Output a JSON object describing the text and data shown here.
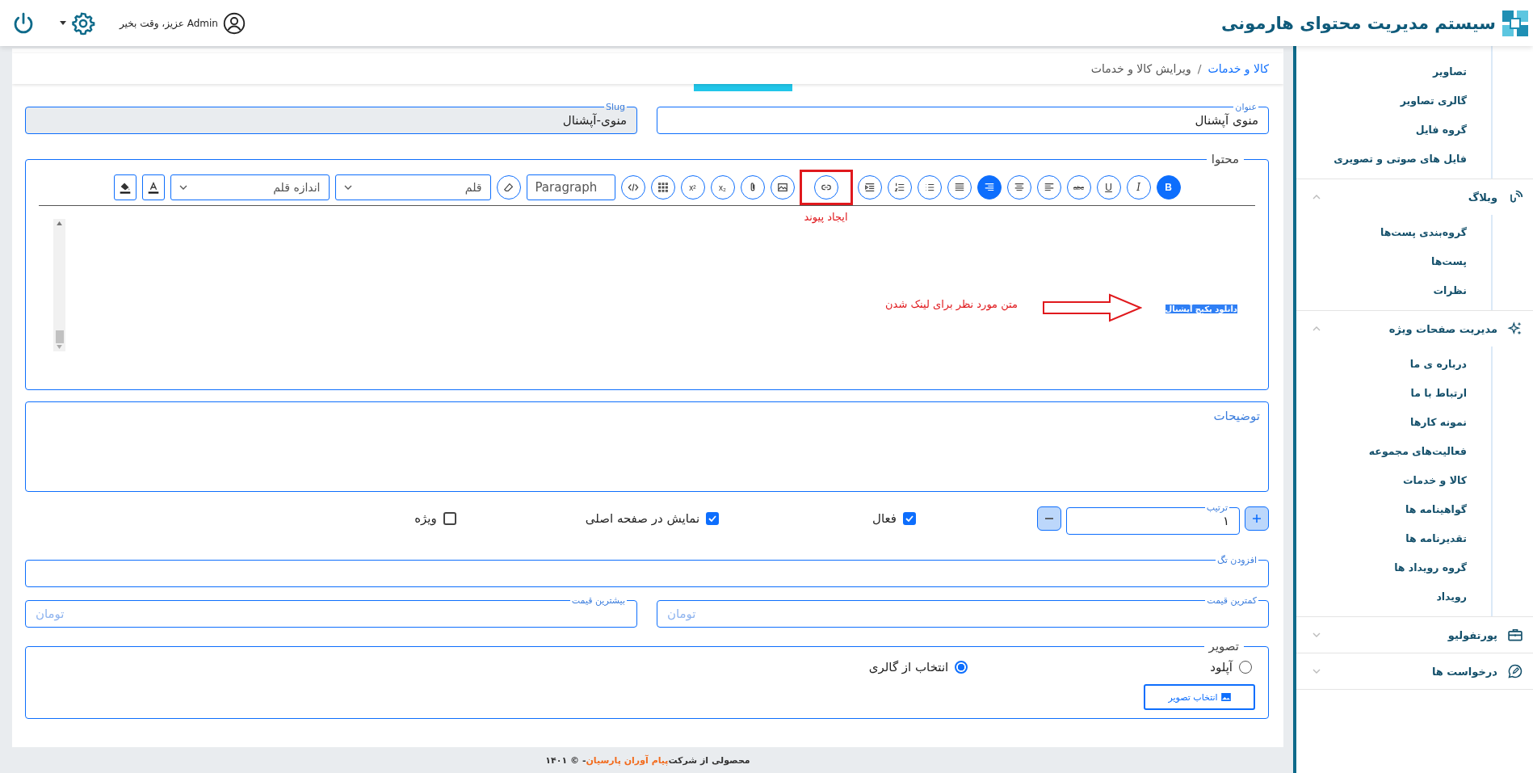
{
  "header": {
    "brand": "سیستم مدیریت محتوای هارمونی",
    "greeting": "Admin عزیز، وقت بخیر"
  },
  "breadcrumb": {
    "separator": "/",
    "items": [
      {
        "label": "کالا و خدمات",
        "current": false
      },
      {
        "label": "ویرایش کالا و خدمات",
        "current": true
      }
    ]
  },
  "title_field": {
    "label": "عنوان",
    "value": "منوی آپشنال"
  },
  "slug_field": {
    "label": "Slug",
    "value": "منوی-آپشنال"
  },
  "editor": {
    "legend": "محتوا",
    "toolbar": [
      {
        "kind": "bold",
        "label": "B",
        "selected": true,
        "marked": false
      },
      {
        "kind": "italic",
        "label": "I",
        "selected": false,
        "marked": false
      },
      {
        "kind": "underline",
        "label": "U",
        "selected": false,
        "marked": false
      },
      {
        "kind": "strike",
        "label": "abc",
        "selected": false,
        "marked": false
      },
      {
        "kind": "align-left",
        "selected": false,
        "marked": false
      },
      {
        "kind": "align-center",
        "selected": false,
        "marked": false
      },
      {
        "kind": "align-right",
        "selected": true,
        "marked": false
      },
      {
        "kind": "justify",
        "selected": false,
        "marked": false
      },
      {
        "kind": "bullets",
        "selected": false,
        "marked": false
      },
      {
        "kind": "numbers",
        "selected": false,
        "marked": false
      },
      {
        "kind": "indent",
        "selected": false,
        "marked": false
      },
      {
        "kind": "link",
        "selected": false,
        "marked": true
      },
      {
        "kind": "image",
        "selected": false,
        "marked": false
      },
      {
        "kind": "attach",
        "selected": false,
        "marked": false
      },
      {
        "kind": "sub",
        "label": "x₂",
        "selected": false,
        "marked": false
      },
      {
        "kind": "sup",
        "label": "x²",
        "selected": false,
        "marked": false
      },
      {
        "kind": "table",
        "selected": false,
        "marked": false
      },
      {
        "kind": "code",
        "selected": false,
        "marked": false
      },
      {
        "kind": "format",
        "label": "Paragraph",
        "selected": false,
        "marked": false
      },
      {
        "kind": "eraser",
        "selected": false,
        "marked": false
      },
      {
        "kind": "select",
        "label": "قلم",
        "selected": false,
        "marked": false
      },
      {
        "kind": "select-wide",
        "label": "اندازه قلم",
        "selected": false,
        "marked": false
      },
      {
        "kind": "text-color",
        "selected": false,
        "marked": false
      },
      {
        "kind": "fill-color",
        "selected": false,
        "marked": false
      }
    ],
    "callout": "ایجاد پیوند",
    "selected_text": "دانلود پکیج آپشنال",
    "note": "متن مورد نظر برای لینک شدن"
  },
  "description": {
    "placeholder": "توضیحات"
  },
  "order": {
    "label": "ترتیب",
    "value": "۱"
  },
  "options": [
    {
      "label": "فعال",
      "checked": true
    },
    {
      "label": "نمایش در صفحه اصلی",
      "checked": true
    },
    {
      "label": "ویژه",
      "checked": false
    }
  ],
  "tag_field": {
    "label": "افزودن تگ"
  },
  "price_fields": [
    {
      "label": "کمترین قیمت",
      "placeholder": "تومان"
    },
    {
      "label": "بیشترین قیمت",
      "placeholder": "تومان"
    }
  ],
  "image": {
    "legend": "تصویر",
    "sources": [
      {
        "label": "آپلود",
        "selected": false
      },
      {
        "label": "انتخاب از گالری",
        "selected": true
      }
    ],
    "button": "انتخاب تصویر"
  },
  "footer": {
    "prefix": "محصولی از شرکت",
    "company": "پیام آوران پارسیان",
    "suffix": "- © ۱۴۰۱"
  },
  "sidebar": [
    {
      "expanded": true,
      "children": [
        "تصاویر",
        "گالری تصاویر",
        "گروه فایل",
        "فایل های صوتی و تصویری"
      ]
    },
    {
      "label": "وبلاگ",
      "expanded": true,
      "children": [
        "گروه‌بندی پست‌ها",
        "پست‌ها",
        "نظرات"
      ]
    },
    {
      "label": "مدیریت صفحات ویژه",
      "expanded": true,
      "children": [
        "درباره ی ما",
        "ارتباط با ما",
        "نمونه کارها",
        "فعالیت‌های مجموعه",
        "کالا و خدمات",
        "گواهینامه ها",
        "تقدیرنامه ها",
        "گروه رویداد ها",
        "رویداد"
      ]
    },
    {
      "label": "پورتفولیو",
      "expanded": false
    },
    {
      "label": "درخواست ها",
      "expanded": false
    }
  ]
}
